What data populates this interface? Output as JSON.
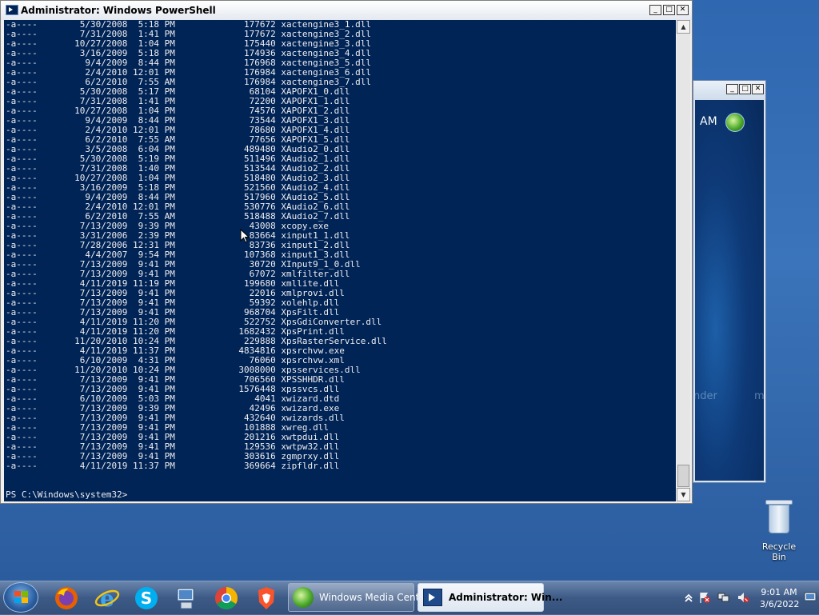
{
  "powershell": {
    "title": "Administrator: Windows PowerShell",
    "rows": [
      [
        "-a----",
        "5/30/2008",
        "5:18 PM",
        "177672",
        "xactengine3_1.dll"
      ],
      [
        "-a----",
        "7/31/2008",
        "1:41 PM",
        "177672",
        "xactengine3_2.dll"
      ],
      [
        "-a----",
        "10/27/2008",
        "1:04 PM",
        "175440",
        "xactengine3_3.dll"
      ],
      [
        "-a----",
        "3/16/2009",
        "5:18 PM",
        "174936",
        "xactengine3_4.dll"
      ],
      [
        "-a----",
        "9/4/2009",
        "8:44 PM",
        "176968",
        "xactengine3_5.dll"
      ],
      [
        "-a----",
        "2/4/2010",
        "12:01 PM",
        "176984",
        "xactengine3_6.dll"
      ],
      [
        "-a----",
        "6/2/2010",
        "7:55 AM",
        "176984",
        "xactengine3_7.dll"
      ],
      [
        "-a----",
        "5/30/2008",
        "5:17 PM",
        "68104",
        "XAPOFX1_0.dll"
      ],
      [
        "-a----",
        "7/31/2008",
        "1:41 PM",
        "72200",
        "XAPOFX1_1.dll"
      ],
      [
        "-a----",
        "10/27/2008",
        "1:04 PM",
        "74576",
        "XAPOFX1_2.dll"
      ],
      [
        "-a----",
        "9/4/2009",
        "8:44 PM",
        "73544",
        "XAPOFX1_3.dll"
      ],
      [
        "-a----",
        "2/4/2010",
        "12:01 PM",
        "78680",
        "XAPOFX1_4.dll"
      ],
      [
        "-a----",
        "6/2/2010",
        "7:55 AM",
        "77656",
        "XAPOFX1_5.dll"
      ],
      [
        "-a----",
        "3/5/2008",
        "6:04 PM",
        "489480",
        "XAudio2_0.dll"
      ],
      [
        "-a----",
        "5/30/2008",
        "5:19 PM",
        "511496",
        "XAudio2_1.dll"
      ],
      [
        "-a----",
        "7/31/2008",
        "1:40 PM",
        "513544",
        "XAudio2_2.dll"
      ],
      [
        "-a----",
        "10/27/2008",
        "1:04 PM",
        "518480",
        "XAudio2_3.dll"
      ],
      [
        "-a----",
        "3/16/2009",
        "5:18 PM",
        "521560",
        "XAudio2_4.dll"
      ],
      [
        "-a----",
        "9/4/2009",
        "8:44 PM",
        "517960",
        "XAudio2_5.dll"
      ],
      [
        "-a----",
        "2/4/2010",
        "12:01 PM",
        "530776",
        "XAudio2_6.dll"
      ],
      [
        "-a----",
        "6/2/2010",
        "7:55 AM",
        "518488",
        "XAudio2_7.dll"
      ],
      [
        "-a----",
        "7/13/2009",
        "9:39 PM",
        "43008",
        "xcopy.exe"
      ],
      [
        "-a----",
        "3/31/2006",
        "2:39 PM",
        "83664",
        "xinput1_1.dll"
      ],
      [
        "-a----",
        "7/28/2006",
        "12:31 PM",
        "83736",
        "xinput1_2.dll"
      ],
      [
        "-a----",
        "4/4/2007",
        "9:54 PM",
        "107368",
        "xinput1_3.dll"
      ],
      [
        "-a----",
        "7/13/2009",
        "9:41 PM",
        "30720",
        "XInput9_1_0.dll"
      ],
      [
        "-a----",
        "7/13/2009",
        "9:41 PM",
        "67072",
        "xmlfilter.dll"
      ],
      [
        "-a----",
        "4/11/2019",
        "11:19 PM",
        "199680",
        "xmllite.dll"
      ],
      [
        "-a----",
        "7/13/2009",
        "9:41 PM",
        "22016",
        "xmlprovi.dll"
      ],
      [
        "-a----",
        "7/13/2009",
        "9:41 PM",
        "59392",
        "xolehlp.dll"
      ],
      [
        "-a----",
        "7/13/2009",
        "9:41 PM",
        "968704",
        "XpsFilt.dll"
      ],
      [
        "-a----",
        "4/11/2019",
        "11:20 PM",
        "522752",
        "XpsGdiConverter.dll"
      ],
      [
        "-a----",
        "4/11/2019",
        "11:20 PM",
        "1682432",
        "XpsPrint.dll"
      ],
      [
        "-a----",
        "11/20/2010",
        "10:24 PM",
        "229888",
        "XpsRasterService.dll"
      ],
      [
        "-a----",
        "4/11/2019",
        "11:37 PM",
        "4834816",
        "xpsrchvw.exe"
      ],
      [
        "-a----",
        "6/10/2009",
        "4:31 PM",
        "76060",
        "xpsrchvw.xml"
      ],
      [
        "-a----",
        "11/20/2010",
        "10:24 PM",
        "3008000",
        "xpsservices.dll"
      ],
      [
        "-a----",
        "7/13/2009",
        "9:41 PM",
        "706560",
        "XPSSHHDR.dll"
      ],
      [
        "-a----",
        "7/13/2009",
        "9:41 PM",
        "1576448",
        "xpssvcs.dll"
      ],
      [
        "-a----",
        "6/10/2009",
        "5:03 PM",
        "4041",
        "xwizard.dtd"
      ],
      [
        "-a----",
        "7/13/2009",
        "9:39 PM",
        "42496",
        "xwizard.exe"
      ],
      [
        "-a----",
        "7/13/2009",
        "9:41 PM",
        "432640",
        "xwizards.dll"
      ],
      [
        "-a----",
        "7/13/2009",
        "9:41 PM",
        "101888",
        "xwreg.dll"
      ],
      [
        "-a----",
        "7/13/2009",
        "9:41 PM",
        "201216",
        "xwtpdui.dll"
      ],
      [
        "-a----",
        "7/13/2009",
        "9:41 PM",
        "129536",
        "xwtpw32.dll"
      ],
      [
        "-a----",
        "7/13/2009",
        "9:41 PM",
        "303616",
        "zgmprxy.dll"
      ],
      [
        "-a----",
        "4/11/2019",
        "11:37 PM",
        "369664",
        "zipfldr.dll"
      ]
    ],
    "prompt": "PS C:\\Windows\\system32>",
    "colors": {
      "console_bg": "#012456",
      "console_fg": "#eeedf0"
    }
  },
  "background_window": {
    "time_text": "AM",
    "faint_text_1": "nder",
    "faint_text_2": "m"
  },
  "desktop": {
    "recycle_bin_label": "Recycle Bin"
  },
  "taskbar": {
    "pinned": [
      "start-orb",
      "firefox-icon",
      "internet-explorer-icon",
      "skype-icon",
      "remote-desktop-icon",
      "chrome-icon",
      "brave-icon"
    ],
    "buttons": [
      {
        "label": "Windows Media Center",
        "active": false
      },
      {
        "label": "Administrator: Win...",
        "active": true
      }
    ],
    "tray_icons": [
      "show-hidden-icons-chevron",
      "action-center-flag-icon",
      "network-icon",
      "volume-muted-icon"
    ],
    "clock_time": "9:01 AM",
    "clock_date": "3/6/2022"
  }
}
